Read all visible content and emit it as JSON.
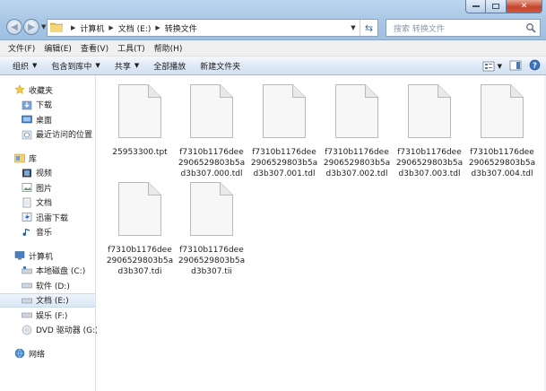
{
  "address": {
    "crumbs": [
      "计算机",
      "文档 (E:)",
      "转换文件"
    ]
  },
  "search": {
    "placeholder": "搜索 转换文件"
  },
  "menu": [
    "文件(F)",
    "编辑(E)",
    "查看(V)",
    "工具(T)",
    "帮助(H)"
  ],
  "commands": {
    "organize": "组织",
    "include": "包含到库中",
    "share": "共享",
    "play_all": "全部播放",
    "new_folder": "新建文件夹"
  },
  "nav": {
    "favorites": "收藏夹",
    "favorites_items": [
      "下载",
      "桌面",
      "最近访问的位置"
    ],
    "libraries": "库",
    "library_items": [
      "视频",
      "图片",
      "文档",
      "迅雷下载",
      "音乐"
    ],
    "computer": "计算机",
    "drives": [
      "本地磁盘 (C:)",
      "软件 (D:)",
      "文档 (E:)",
      "娱乐 (F:)",
      "DVD 驱动器 (G:)"
    ],
    "network": "网络"
  },
  "files": [
    "25953300.tpt",
    "f7310b1176dee2906529803b5ad3b307.000.tdl",
    "f7310b1176dee2906529803b5ad3b307.001.tdl",
    "f7310b1176dee2906529803b5ad3b307.002.tdl",
    "f7310b1176dee2906529803b5ad3b307.003.tdl",
    "f7310b1176dee2906529803b5ad3b307.004.tdl",
    "f7310b1176dee2906529803b5ad3b307.tdi",
    "f7310b1176dee2906529803b5ad3b307.tii"
  ],
  "icons": {
    "back": "back-arrow-icon",
    "forward": "forward-arrow-icon",
    "refresh": "refresh-icon",
    "search": "search-icon",
    "file": "generic-file-icon"
  }
}
